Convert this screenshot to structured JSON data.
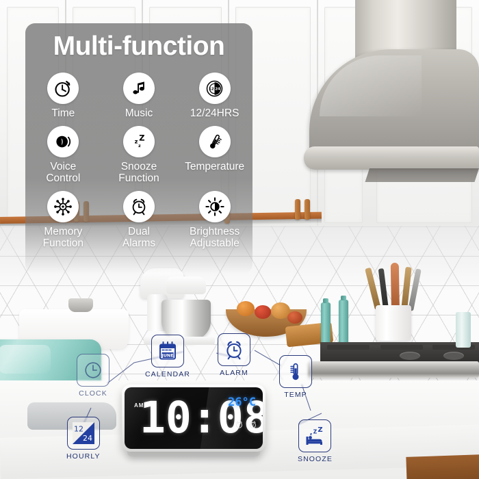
{
  "overlay": {
    "title": "Multi-function",
    "features": [
      {
        "label": "Time",
        "icon": "stopwatch-icon"
      },
      {
        "label": "Music",
        "icon": "music-note-icon"
      },
      {
        "label": "12/24HRS",
        "icon": "twelve-twentyfour-hour-icon"
      },
      {
        "label": "Voice\nControl",
        "icon": "voice-control-icon"
      },
      {
        "label": "Snooze\nFunction",
        "icon": "snooze-zzz-icon"
      },
      {
        "label": "Temperature",
        "icon": "thermometer-icon"
      },
      {
        "label": "Memory\nFunction",
        "icon": "memory-burst-icon"
      },
      {
        "label": "Dual\nAlarms",
        "icon": "alarm-clock-icon"
      },
      {
        "label": "Brightness\nAdjustable",
        "icon": "brightness-icon"
      }
    ]
  },
  "callouts": [
    {
      "id": "clock",
      "label": "CLOCK",
      "icon": "clock-face-icon"
    },
    {
      "id": "calendar",
      "label": "CALENDAR",
      "icon": "calendar-icon",
      "month": "JUNE"
    },
    {
      "id": "alarm",
      "label": "ALARM",
      "icon": "alarm-clock-icon"
    },
    {
      "id": "temp",
      "label": "TEMP",
      "icon": "thermometer-icon"
    },
    {
      "id": "hourly",
      "label": "HOURLY",
      "icon": "twelve-twentyfour-split-icon",
      "top_value": "12",
      "bottom_value": "24"
    },
    {
      "id": "snooze",
      "label": "SNOOZE",
      "icon": "bed-zzz-icon"
    }
  ],
  "device": {
    "ampm": "AM",
    "time": "10:08",
    "temperature": "26°C",
    "alarm_indicator_1": "1",
    "alarm_indicator_2": "2"
  },
  "colors": {
    "callout_blue": "#1e2f6b",
    "icon_blue": "#2340a0",
    "led_white": "#ffffff",
    "led_blue": "#2f8ef7",
    "panel_gray": "#787878"
  }
}
